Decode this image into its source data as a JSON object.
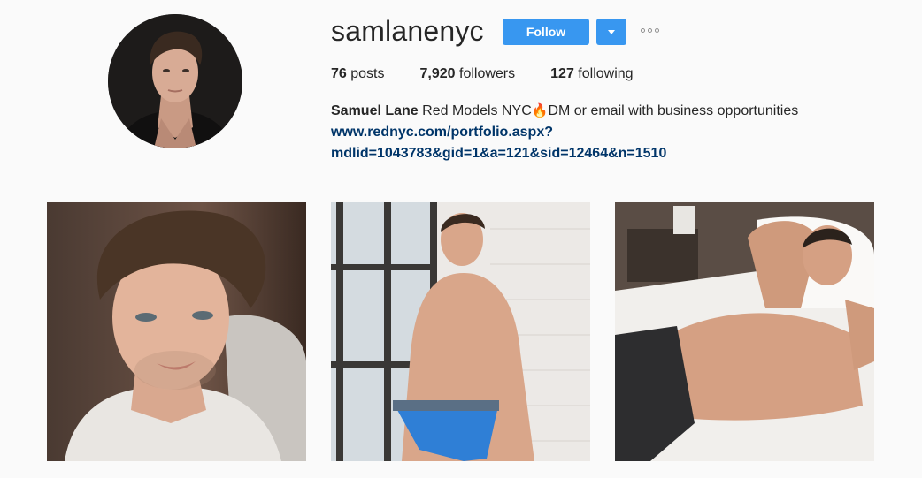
{
  "profile": {
    "username": "samlanenyc",
    "follow_label": "Follow",
    "more_label": "More options"
  },
  "stats": {
    "posts_count": "76",
    "posts_label": "posts",
    "followers_count": "7,920",
    "followers_label": "followers",
    "following_count": "127",
    "following_label": "following"
  },
  "bio": {
    "full_name": "Samuel Lane",
    "text_before_emoji": "Red Models NYC",
    "emoji": "🔥",
    "text_after_emoji": "DM or email with business opportunities",
    "link_line1": "www.rednyc.com/portfolio.aspx?",
    "link_line2": "mdlid=1043783&gid=1&a=121&sid=12464&n=1510"
  },
  "posts": [
    {
      "subject": "selfie in car, white henley shirt"
    },
    {
      "subject": "shirtless by window, blue briefs"
    },
    {
      "subject": "shirtless lying on white bed"
    }
  ],
  "colors": {
    "accent": "#3897f0",
    "link": "#003569",
    "background": "#fafafa",
    "text": "#262626"
  }
}
